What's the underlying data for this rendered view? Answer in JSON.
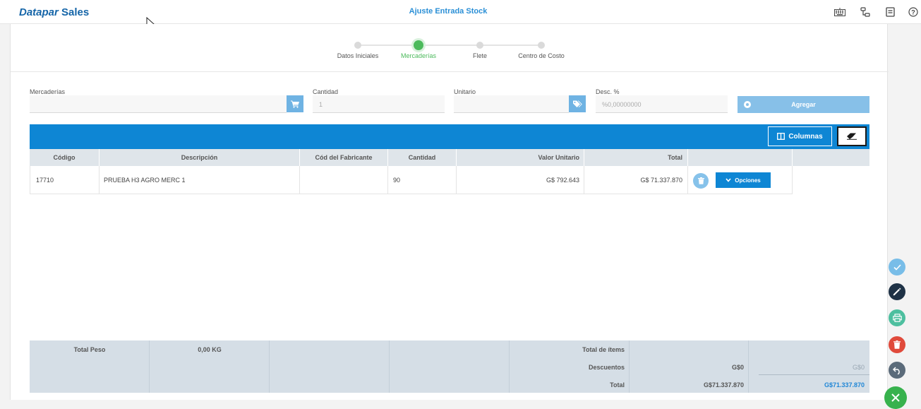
{
  "header": {
    "brand_datapar": "Datapar",
    "brand_sales": "Sales",
    "title": "Ajuste Entrada Stock",
    "icons": [
      "keyboard-icon",
      "sitemap-icon",
      "notes-icon",
      "help-icon"
    ]
  },
  "steps": [
    {
      "label": "Datos Iniciales",
      "active": false
    },
    {
      "label": "Mercaderías",
      "active": true
    },
    {
      "label": "Flete",
      "active": false
    },
    {
      "label": "Centro de Costo",
      "active": false
    }
  ],
  "form": {
    "mercaderias_label": "Mercaderías",
    "mercaderias_value": "",
    "cantidad_label": "Cantidad",
    "cantidad_placeholder": "1",
    "unitario_label": "Unitario",
    "unitario_value": "",
    "desc_label": "Desc. %",
    "desc_placeholder": "%0,00000000",
    "agregar_label": "Agregar"
  },
  "toolbar": {
    "columnas_label": "Columnas"
  },
  "table": {
    "headers": [
      "Código",
      "Descripción",
      "Cód del Fabricante",
      "Cantidad",
      "Valor Unitario",
      "Total"
    ],
    "rows": [
      {
        "codigo": "17710",
        "descripcion": "PRUEBA H3 AGRO MERC 1",
        "cod_fabricante": "",
        "cantidad": "90",
        "valor_unitario": "G$ 792.643",
        "total": "G$ 71.337.870",
        "opciones_label": "Opciones"
      }
    ]
  },
  "totals": {
    "total_peso_label": "Total Peso",
    "total_peso_value": "0,00 KG",
    "total_items_label": "Total de ítems",
    "descuentos_label": "Descuentos",
    "descuentos_value": "G$0",
    "descuentos_extra": "G$0",
    "total_label": "Total",
    "total_value": "G$71.337.870",
    "total_extra": "G$71.337.870"
  },
  "colors": {
    "primary": "#0e86d4",
    "active_step": "#4cba5c",
    "footer_bg": "#d5dee6"
  },
  "side_actions": [
    "check-icon",
    "pencil-icon",
    "print-icon",
    "trash-icon",
    "undo-icon",
    "close-icon"
  ]
}
